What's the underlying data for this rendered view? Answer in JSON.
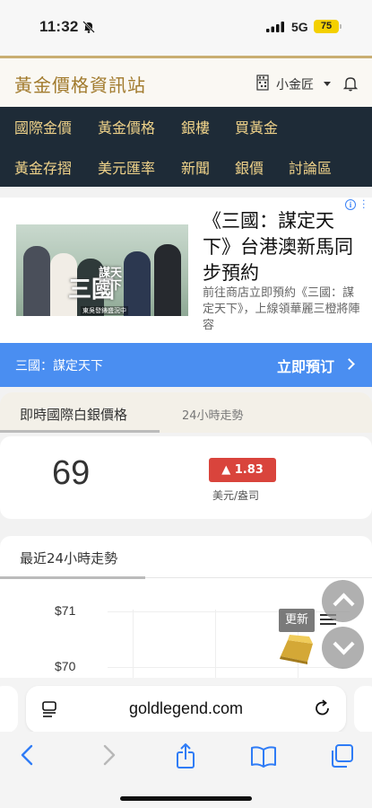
{
  "status_bar": {
    "time": "11:32",
    "network": "5G",
    "battery": "75"
  },
  "header": {
    "site_title": "黃金價格資訊站",
    "user_label": "小金匠"
  },
  "nav": {
    "row1": [
      "國際金價",
      "黃金價格",
      "銀樓",
      "買黃金"
    ],
    "row2": [
      "黃金存摺",
      "美元匯率",
      "新聞",
      "銀價",
      "討論區"
    ]
  },
  "ad": {
    "title": "《三國：謀定天下》台港澳新馬同步預約",
    "description": "前往商店立即預約《三國：謀定天下》，上線領華麗三橙將陣容",
    "image_brand": "三國",
    "image_brand_sub": "謀天定下",
    "image_tagline": "東吳發錶盛況中",
    "bar_left": "三國：謀定天下",
    "bar_right": "立即預订"
  },
  "silver": {
    "tab_active": "即時國際白銀價格",
    "tab_other": "24小時走勢",
    "price": "69",
    "change": "▲ 1.83",
    "unit": "美元/盎司",
    "colors": {
      "up": "#d9443c"
    }
  },
  "trend": {
    "title": "最近24小時走勢",
    "update_label": "更新"
  },
  "chart_data": {
    "type": "line",
    "title": "",
    "xlabel": "",
    "ylabel": "",
    "y_tick_labels": [
      "$71",
      "$70"
    ],
    "ylim": [
      70,
      71
    ],
    "series": []
  },
  "browser": {
    "url": "goldlegend.com"
  }
}
